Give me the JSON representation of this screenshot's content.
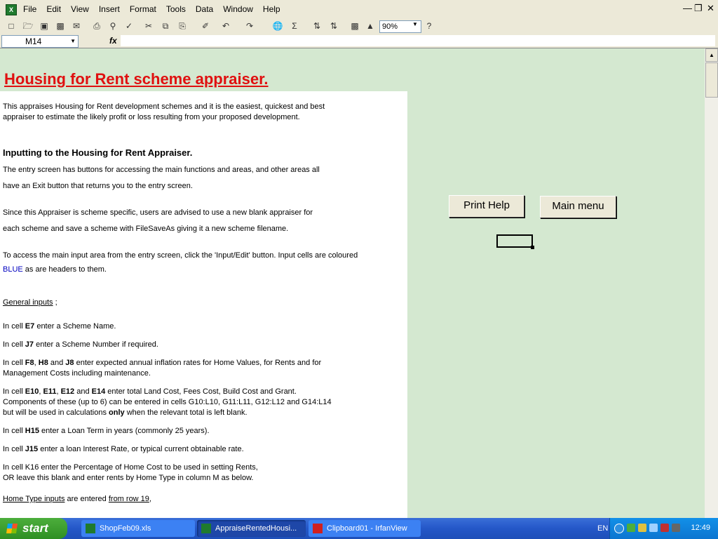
{
  "menubar": {
    "items": [
      "File",
      "Edit",
      "View",
      "Insert",
      "Format",
      "Tools",
      "Data",
      "Window",
      "Help"
    ]
  },
  "toolbar": {
    "zoom": "90%"
  },
  "formulabar": {
    "namebox": "M14",
    "fx": "fx",
    "value": ""
  },
  "sheet": {
    "title": "Housing for Rent scheme appraiser.",
    "intro_1": "This appraises Housing for Rent development schemes and it is the easiest, quickest and best",
    "intro_2": "appraiser to estimate the likely profit or loss resulting from your proposed development.",
    "heading": "Inputting to the Housing for Rent Appraiser.",
    "p1_1": "The entry screen has buttons for accessing the main functions and areas, and other areas all",
    "p1_2": "have an Exit button that returns you to the entry screen.",
    "p2_1": "Since this Appraiser is scheme specific, users are advised to use a new blank appraiser for",
    "p2_2": "each scheme and save a scheme with FileSaveAs giving it a new scheme filename.",
    "p3_1": "To access the main input area from the entry screen, click the 'Input/Edit' button. Input cells are coloured",
    "p3_blue": "BLUE",
    "p3_2": " as are headers to them.",
    "general_inputs": "General inputs",
    "general_suffix": " ;",
    "e7": {
      "pre": "In cell ",
      "cell": "E7",
      "post": " enter a Scheme Name."
    },
    "j7": {
      "pre": "In cell ",
      "cell": "J7",
      "post": " enter a Scheme Number if required."
    },
    "f8": {
      "pre": "In cell ",
      "c1": "F8",
      "sep1": ", ",
      "c2": "H8",
      "sep2": " and ",
      "c3": "J8",
      "post": " enter expected annual inflation rates for Home Values, for Rents and for",
      "line2": "Management Costs including maintenance."
    },
    "e10": {
      "pre": "In cell ",
      "c1": "E10",
      "sep1": ", ",
      "c2": "E11",
      "sep2": ", ",
      "c3": "E12",
      "sep3": " and ",
      "c4": "E14",
      "post": " enter total Land Cost, Fees Cost, Build Cost and Grant.",
      "line2": "Components of these (up to 6) can be entered in cells G10:L10, G11:L11, G12:L12 and G14:L14",
      "line3_pre": "but will be used in calculations ",
      "line3_bold": "only",
      "line3_post": " when the relevant total is left blank."
    },
    "h15": {
      "pre": "In cell ",
      "cell": "H15",
      "post": " enter a Loan Term in years (commonly 25 years)."
    },
    "j15": {
      "pre": "In cell ",
      "cell": "J15",
      "post": " enter a loan Interest Rate, or typical current obtainable rate."
    },
    "k16": {
      "line1": "In cell K16 enter the Percentage of Home Cost to be used in setting Rents,",
      "line2": "OR leave this blank and enter rents by Home Type in column M as below."
    },
    "home_type": {
      "link1": "Home Type inputs",
      "mid": " are entered ",
      "link2": "from row 19",
      "end": ","
    },
    "print_help": "Print Help",
    "main_menu": "Main menu"
  },
  "taskbar": {
    "start": "start",
    "tasks": [
      "ShopFeb09.xls",
      "AppraiseRentedHousi...",
      "Clipboard01 - IrfanView"
    ],
    "lang": "EN",
    "clock": "12:49"
  }
}
